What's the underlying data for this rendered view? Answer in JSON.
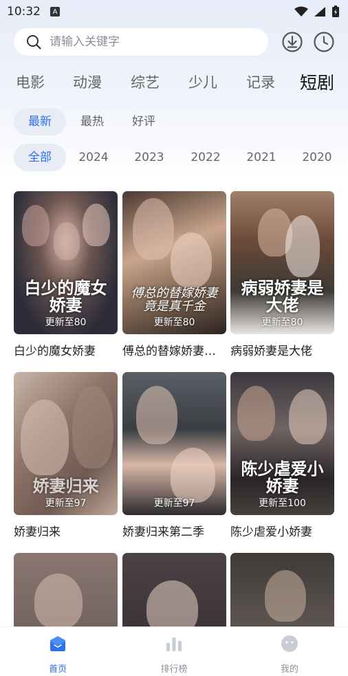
{
  "status_bar": {
    "time": "10:32",
    "notification_icon": "A"
  },
  "search": {
    "placeholder": "请输入关键字"
  },
  "header_icons": {
    "download": "download-icon",
    "history": "clock-icon"
  },
  "category_tabs": [
    {
      "label": "电影",
      "active": false
    },
    {
      "label": "动漫",
      "active": false
    },
    {
      "label": "综艺",
      "active": false
    },
    {
      "label": "少儿",
      "active": false
    },
    {
      "label": "记录",
      "active": false
    },
    {
      "label": "短剧",
      "active": true
    }
  ],
  "sort_filters": [
    {
      "label": "最新",
      "active": true
    },
    {
      "label": "最热",
      "active": false
    },
    {
      "label": "好评",
      "active": false
    }
  ],
  "year_filters": [
    {
      "label": "全部",
      "active": true
    },
    {
      "label": "2024",
      "active": false
    },
    {
      "label": "2023",
      "active": false
    },
    {
      "label": "2022",
      "active": false
    },
    {
      "label": "2021",
      "active": false
    },
    {
      "label": "2020",
      "active": false
    }
  ],
  "items": [
    {
      "title": "白少的魔女娇妻",
      "episodes": "更新至80",
      "poster_text": "白少的魔女娇妻"
    },
    {
      "title": "傅总的替嫁娇妻…",
      "episodes": "更新至80",
      "poster_text": "傅总的替嫁娇妻竟是真千金"
    },
    {
      "title": "病弱娇妻是大佬",
      "episodes": "更新至80",
      "poster_text": "病弱娇妻是大佬"
    },
    {
      "title": "娇妻归来",
      "episodes": "更新至97",
      "poster_text": "娇妻归来"
    },
    {
      "title": "娇妻归来第二季",
      "episodes": "更新至97",
      "poster_text": ""
    },
    {
      "title": "陈少虐爱小娇妻",
      "episodes": "更新至100",
      "poster_text": "陈少虐爱小娇妻"
    },
    {
      "title": "",
      "episodes": "",
      "poster_text": ""
    },
    {
      "title": "",
      "episodes": "",
      "poster_text": ""
    },
    {
      "title": "",
      "episodes": "",
      "poster_text": ""
    }
  ],
  "bottom_nav": [
    {
      "label": "首页",
      "icon": "home-icon",
      "active": true
    },
    {
      "label": "排行榜",
      "icon": "bar-chart-icon",
      "active": false
    },
    {
      "label": "我的",
      "icon": "profile-icon",
      "active": false
    }
  ],
  "colors": {
    "accent": "#2f6ff2",
    "chip_bg": "#e7ecf5",
    "muted": "#8a8f99"
  }
}
